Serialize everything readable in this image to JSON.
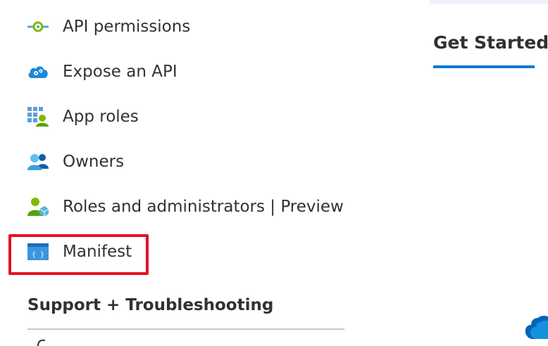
{
  "sidebar": {
    "items": [
      {
        "id": "api-permissions",
        "label": "API permissions",
        "icon": "api-permissions-icon"
      },
      {
        "id": "expose-api",
        "label": "Expose an API",
        "icon": "cloud-gear-icon"
      },
      {
        "id": "app-roles",
        "label": "App roles",
        "icon": "app-roles-icon"
      },
      {
        "id": "owners",
        "label": "Owners",
        "icon": "owners-icon"
      },
      {
        "id": "roles-admins",
        "label": "Roles and administrators | Preview",
        "icon": "roles-admin-icon"
      },
      {
        "id": "manifest",
        "label": "Manifest",
        "icon": "manifest-icon"
      }
    ],
    "section_header": "Support + Troubleshooting"
  },
  "main": {
    "tabs": [
      {
        "label": "Get Started",
        "selected": true
      }
    ]
  },
  "colors": {
    "accent": "#0078d4",
    "highlight": "#e81123",
    "text": "#323130",
    "divider": "#c8c6c4"
  }
}
